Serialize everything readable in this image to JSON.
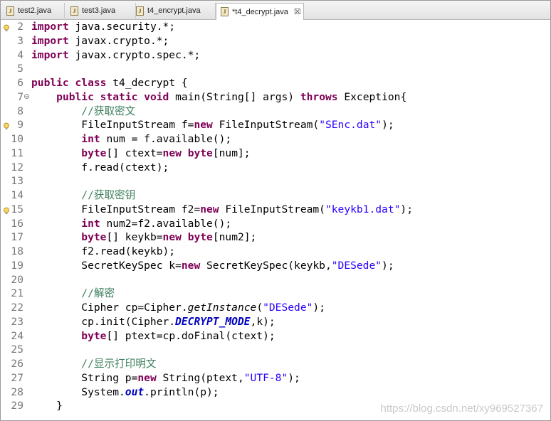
{
  "tabs": [
    {
      "label": "test2.java"
    },
    {
      "label": "test3.java"
    },
    {
      "label": "t4_encrypt.java"
    },
    {
      "label": "*t4_decrypt.java",
      "close": "☒"
    }
  ],
  "code_lines": [
    {
      "n": "2",
      "text": "import java.security.*;"
    },
    {
      "n": "3",
      "text": "import javax.crypto.*;"
    },
    {
      "n": "4",
      "text": "import javax.crypto.spec.*;"
    },
    {
      "n": "5",
      "text": ""
    },
    {
      "n": "6",
      "text": "public class t4_decrypt {"
    },
    {
      "n": "7",
      "text": "    public static void main(String[] args) throws Exception{"
    },
    {
      "n": "8",
      "text": "        //获取密文"
    },
    {
      "n": "9",
      "text": "        FileInputStream f=new FileInputStream(\"SEnc.dat\");"
    },
    {
      "n": "10",
      "text": "        int num = f.available();"
    },
    {
      "n": "11",
      "text": "        byte[] ctext=new byte[num];"
    },
    {
      "n": "12",
      "text": "        f.read(ctext);"
    },
    {
      "n": "13",
      "text": ""
    },
    {
      "n": "14",
      "text": "        //获取密钥"
    },
    {
      "n": "15",
      "text": "        FileInputStream f2=new FileInputStream(\"keykb1.dat\");"
    },
    {
      "n": "16",
      "text": "        int num2=f2.available();"
    },
    {
      "n": "17",
      "text": "        byte[] keykb=new byte[num2];"
    },
    {
      "n": "18",
      "text": "        f2.read(keykb);"
    },
    {
      "n": "19",
      "text": "        SecretKeySpec k=new SecretKeySpec(keykb,\"DESede\");"
    },
    {
      "n": "20",
      "text": ""
    },
    {
      "n": "21",
      "text": "        //解密"
    },
    {
      "n": "22",
      "text": "        Cipher cp=Cipher.getInstance(\"DESede\");"
    },
    {
      "n": "23",
      "text": "        cp.init(Cipher.DECRYPT_MODE,k);"
    },
    {
      "n": "24",
      "text": "        byte[] ptext=cp.doFinal(ctext);"
    },
    {
      "n": "25",
      "text": ""
    },
    {
      "n": "26",
      "text": "        //显示打印明文"
    },
    {
      "n": "27",
      "text": "        String p=new String(ptext,\"UTF-8\");"
    },
    {
      "n": "28",
      "text": "        System.out.println(p);"
    },
    {
      "n": "29",
      "text": "    }"
    }
  ],
  "watermark": "https://blog.csdn.net/xy969527367",
  "colors": {
    "keyword": "#7f0055",
    "string": "#2a00ff",
    "comment": "#3f7f5f",
    "field": "#0000c0"
  },
  "icons": {
    "tab_icon": "java-file-icon",
    "warning": "warning-lightbulb-icon",
    "fold": "fold-collapse-icon",
    "close": "close-icon"
  }
}
